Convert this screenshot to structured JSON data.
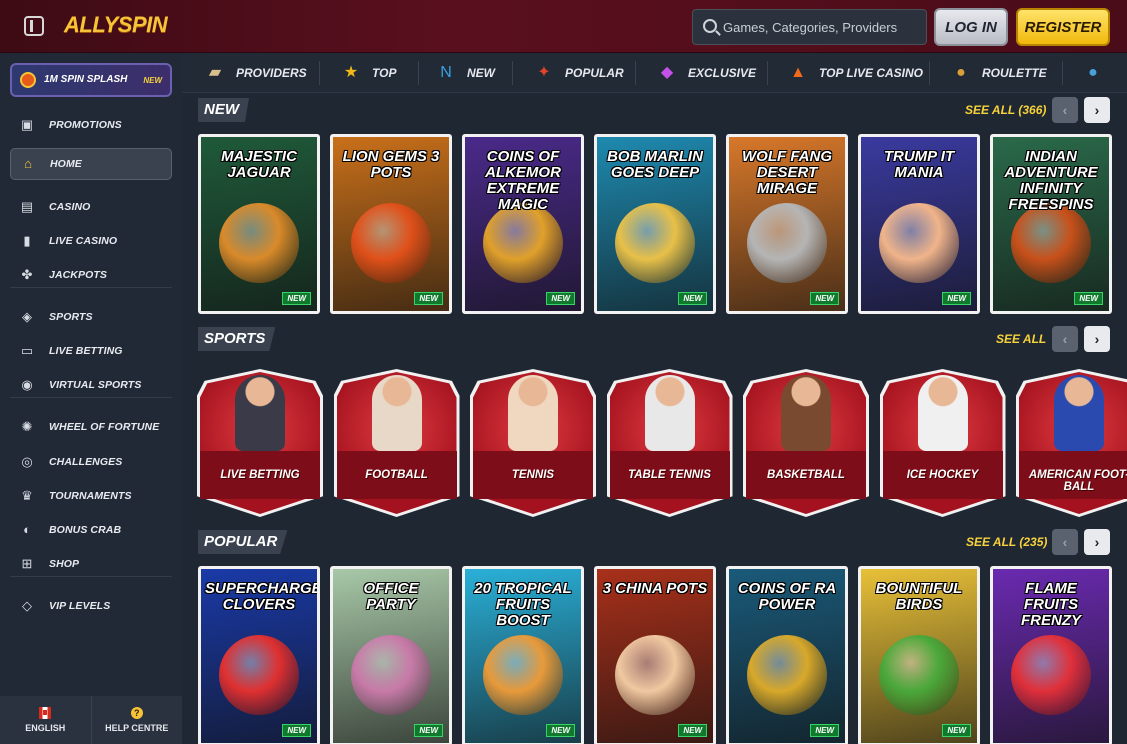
{
  "header": {
    "logo_text": "ALLYSPIN",
    "search_placeholder": "Games, Categories, Providers",
    "login_label": "LOG IN",
    "register_label": "REGISTER"
  },
  "sidebar": {
    "promo": {
      "label": "1M SPIN SPLASH",
      "badge": "NEW"
    },
    "items": [
      {
        "label": "PROMOTIONS",
        "icon": "gift-icon"
      },
      {
        "label": "HOME",
        "icon": "home-icon",
        "active": true
      },
      {
        "label": "CASINO",
        "icon": "slot-icon"
      },
      {
        "label": "LIVE CASINO",
        "icon": "card-icon"
      },
      {
        "label": "JACKPOTS",
        "icon": "clover-icon"
      },
      {
        "label": "SPORTS",
        "icon": "football-icon"
      },
      {
        "label": "LIVE BETTING",
        "icon": "live-icon"
      },
      {
        "label": "VIRTUAL SPORTS",
        "icon": "soccer-icon"
      },
      {
        "label": "WHEEL OF FORTUNE",
        "icon": "wheel-icon"
      },
      {
        "label": "CHALLENGES",
        "icon": "medal-icon"
      },
      {
        "label": "TOURNAMENTS",
        "icon": "trophy-icon"
      },
      {
        "label": "BONUS CRAB",
        "icon": "crab-icon"
      },
      {
        "label": "SHOP",
        "icon": "cart-icon"
      },
      {
        "label": "VIP LEVELS",
        "icon": "diamond-icon"
      }
    ],
    "footer": {
      "language": "ENGLISH",
      "help": "HELP CENTRE"
    }
  },
  "categories": [
    {
      "label": "PROVIDERS",
      "icon": "providers-icon",
      "glyph": "▰",
      "color": "#d9c08a"
    },
    {
      "label": "TOP",
      "icon": "star-icon",
      "glyph": "★",
      "color": "#f2b818"
    },
    {
      "label": "NEW",
      "icon": "new-icon",
      "glyph": "N",
      "color": "#3aa0e0"
    },
    {
      "label": "POPULAR",
      "icon": "rocket-icon",
      "glyph": "✦",
      "color": "#e0442a"
    },
    {
      "label": "EXCLUSIVE",
      "icon": "gem-icon",
      "glyph": "◆",
      "color": "#c451e8"
    },
    {
      "label": "TOP LIVE CASINO",
      "icon": "fire-icon",
      "glyph": "▲",
      "color": "#f06a1a"
    },
    {
      "label": "ROULETTE",
      "icon": "roulette-icon",
      "glyph": "●",
      "color": "#d9a03a"
    }
  ],
  "sections": {
    "new": {
      "title": "NEW",
      "see_all": "SEE ALL (366)",
      "games": [
        {
          "title": "MAJESTIC JAGUAR",
          "badge": "NEW",
          "bg": "#1f5a3a",
          "art": "#d98a2a"
        },
        {
          "title": "LION GEMS 3 POTS",
          "badge": "NEW",
          "bg": "#c9701a",
          "art": "#e0501a"
        },
        {
          "title": "COINS OF ALKEMOR EXTREME MAGIC",
          "badge": "NEW",
          "bg": "#4a2a8a",
          "art": "#e0a02a"
        },
        {
          "title": "BOB MARLIN GOES DEEP",
          "badge": "NEW",
          "bg": "#1e8ab0",
          "art": "#e8c048"
        },
        {
          "title": "WOLF FANG DESERT MIRAGE",
          "badge": "NEW",
          "bg": "#d8782a",
          "art": "#b5b5b5"
        },
        {
          "title": "TRUMP IT MANIA",
          "badge": "NEW",
          "bg": "#3a3aa0",
          "art": "#f0b48a"
        },
        {
          "title": "INDIAN ADVENTURE INFINITY FREESPINS",
          "badge": "NEW",
          "bg": "#2a6a4a",
          "art": "#c8501a"
        }
      ]
    },
    "sports": {
      "title": "SPORTS",
      "see_all": "SEE ALL",
      "items": [
        {
          "label": "LIVE BETTING",
          "fig": "#3a3a48"
        },
        {
          "label": "FOOTBALL",
          "fig": "#e8d8c8"
        },
        {
          "label": "TENNIS",
          "fig": "#f0d8c0"
        },
        {
          "label": "TABLE TENNIS",
          "fig": "#e8e8e8"
        },
        {
          "label": "BASKETBALL",
          "fig": "#7a4a30"
        },
        {
          "label": "ICE HOCKEY",
          "fig": "#f0f0f0"
        },
        {
          "label": "AMERICAN FOOT-BALL",
          "fig": "#2a4ab0"
        }
      ]
    },
    "popular": {
      "title": "POPULAR",
      "see_all": "SEE ALL (235)",
      "games": [
        {
          "title": "SUPERCHARGED CLOVERS",
          "badge": "NEW",
          "bg": "#1a3aa8",
          "art": "#e03030"
        },
        {
          "title": "OFFICE PARTY",
          "badge": "NEW",
          "bg": "#a8c8a8",
          "art": "#c87aa8"
        },
        {
          "title": "20 TROPICAL FRUITS BOOST",
          "badge": "NEW",
          "bg": "#2ab0d8",
          "art": "#e89a3a"
        },
        {
          "title": "3 CHINA POTS",
          "badge": "NEW",
          "bg": "#a8301a",
          "art": "#f0c8a0"
        },
        {
          "title": "COINS OF RA POWER",
          "badge": "NEW",
          "bg": "#1a5a7a",
          "art": "#d8a82a"
        },
        {
          "title": "BOUNTIFUL BIRDS",
          "badge": "NEW",
          "bg": "#e8c038",
          "art": "#4aa83a"
        },
        {
          "title": "FLAME FRUITS FRENZY",
          "badge": "",
          "bg": "#6a2ab0",
          "art": "#e0303a"
        }
      ]
    }
  }
}
